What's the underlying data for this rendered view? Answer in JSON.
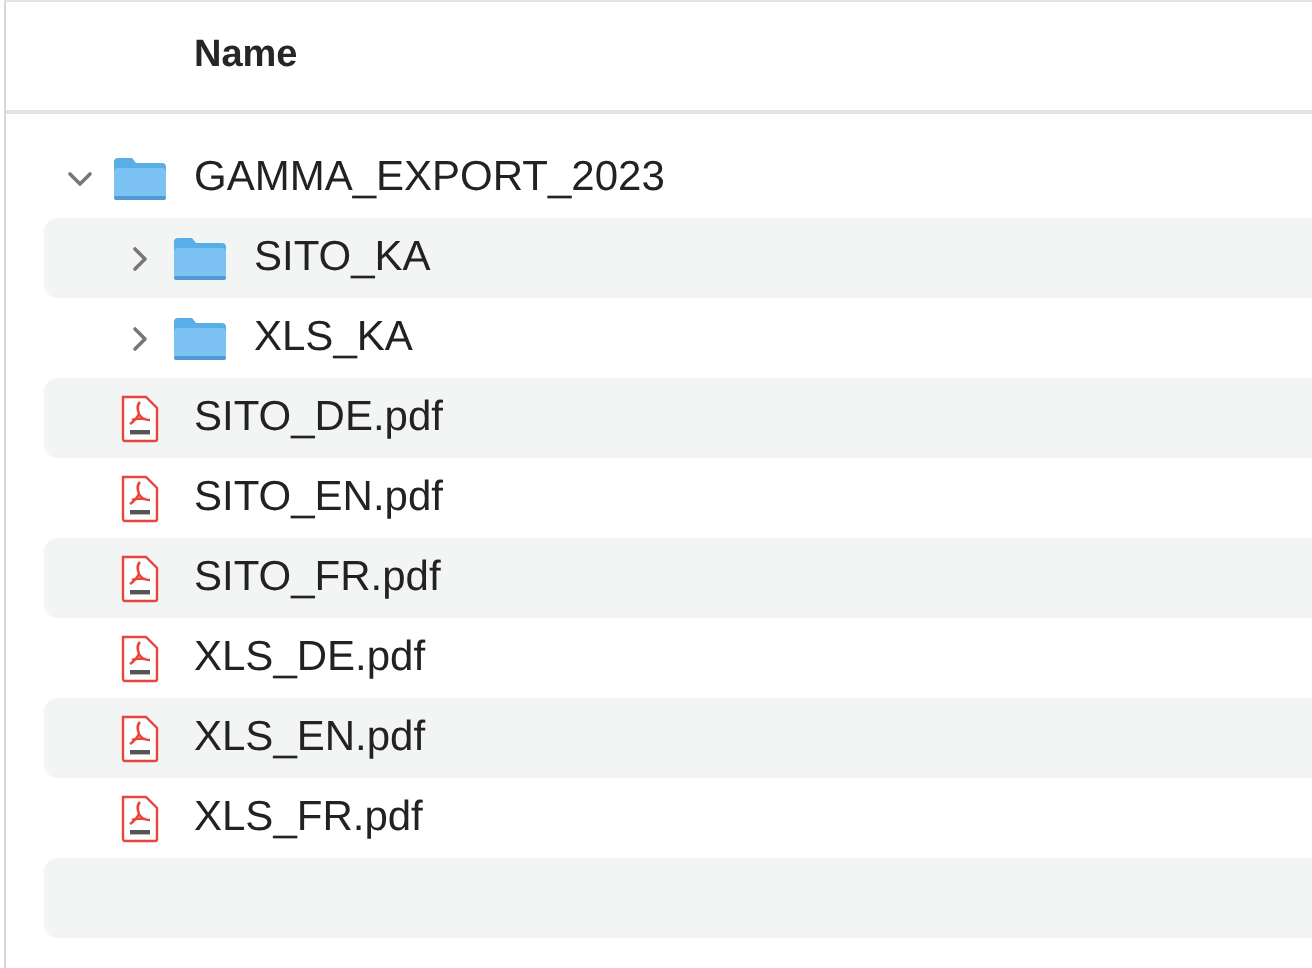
{
  "header": {
    "column": "Name"
  },
  "items": [
    {
      "name": "GAMMA_EXPORT_2023",
      "kind": "folder",
      "expanded": true,
      "children": [
        {
          "name": "SITO_KA",
          "kind": "folder",
          "expanded": false
        },
        {
          "name": "XLS_KA",
          "kind": "folder",
          "expanded": false
        }
      ]
    },
    {
      "name": "SITO_DE.pdf",
      "kind": "pdf"
    },
    {
      "name": "SITO_EN.pdf",
      "kind": "pdf"
    },
    {
      "name": "SITO_FR.pdf",
      "kind": "pdf"
    },
    {
      "name": "XLS_DE.pdf",
      "kind": "pdf"
    },
    {
      "name": "XLS_EN.pdf",
      "kind": "pdf"
    },
    {
      "name": "XLS_FR.pdf",
      "kind": "pdf"
    }
  ]
}
